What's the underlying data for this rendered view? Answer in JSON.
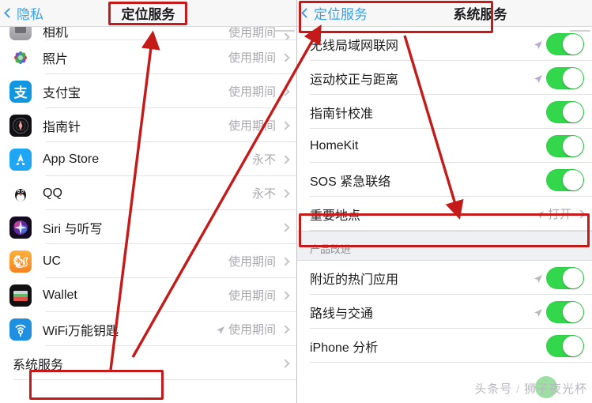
{
  "left_panel": {
    "nav": {
      "back_label": "隐私",
      "title": "定位服务"
    },
    "rows": [
      {
        "label": "相机",
        "value": "使用期间",
        "icon": "camera-app-icon",
        "partial": true
      },
      {
        "label": "照片",
        "value": "使用期间",
        "icon": "photos-app-icon"
      },
      {
        "label": "支付宝",
        "value": "使用期间",
        "icon": "alipay-app-icon"
      },
      {
        "label": "指南针",
        "value": "使用期间",
        "icon": "compass-app-icon"
      },
      {
        "label": "App Store",
        "value": "永不",
        "icon": "appstore-app-icon"
      },
      {
        "label": "QQ",
        "value": "永不",
        "icon": "qq-app-icon"
      },
      {
        "label": "Siri 与听写",
        "value": "",
        "icon": "siri-app-icon"
      },
      {
        "label": "UC",
        "value": "使用期间",
        "icon": "uc-browser-app-icon"
      },
      {
        "label": "Wallet",
        "value": "使用期间",
        "icon": "wallet-app-icon"
      },
      {
        "label": "WiFi万能钥匙",
        "value": "使用期间",
        "icon": "wifi-master-key-app-icon",
        "arrow": true
      },
      {
        "label": "系统服务",
        "value": "",
        "icon": null,
        "highlight": true
      }
    ]
  },
  "right_panel": {
    "nav": {
      "back_label": "定位服务",
      "title": "系统服务"
    },
    "rows": [
      {
        "label": "无线局域网联网",
        "control": "toggle",
        "toggle_on": true,
        "arrow": "purple"
      },
      {
        "label": "运动校正与距离",
        "control": "toggle",
        "toggle_on": true,
        "arrow": "purple"
      },
      {
        "label": "指南针校准",
        "control": "toggle",
        "toggle_on": true,
        "arrow": "none"
      },
      {
        "label": "HomeKit",
        "control": "toggle",
        "toggle_on": true,
        "arrow": "none"
      },
      {
        "label": "SOS 紧急联络",
        "control": "toggle",
        "toggle_on": true,
        "arrow": "none"
      },
      {
        "label": "重要地点",
        "control": "disclosure",
        "value": "打开",
        "arrow": "grey",
        "highlight": true
      }
    ],
    "section_header": "产品改进",
    "section_rows": [
      {
        "label": "附近的热门应用",
        "control": "toggle",
        "toggle_on": true,
        "arrow": "grey"
      },
      {
        "label": "路线与交通",
        "control": "toggle",
        "toggle_on": true,
        "arrow": "grey"
      },
      {
        "label": "iPhone 分析",
        "control": "toggle",
        "toggle_on": true,
        "arrow": "none"
      }
    ]
  },
  "annotations": {
    "color": "#c41a1a",
    "boxes": [
      {
        "name": "left-title-box"
      },
      {
        "name": "left-system-services-box"
      },
      {
        "name": "right-navbar-box"
      },
      {
        "name": "right-important-locations-box"
      }
    ],
    "arrows": [
      {
        "name": "arrow-system-services-to-title"
      },
      {
        "name": "arrow-system-services-to-right-nav"
      },
      {
        "name": "arrow-right-nav-to-important-locations"
      }
    ]
  },
  "watermark": {
    "text": "头条号 / 狮子夜光杯"
  },
  "colors": {
    "toggle_on": "#32d74b",
    "accent_blue": "#35a3e8",
    "annotation_red": "#c41a1a",
    "value_grey": "#a9a9ae"
  }
}
